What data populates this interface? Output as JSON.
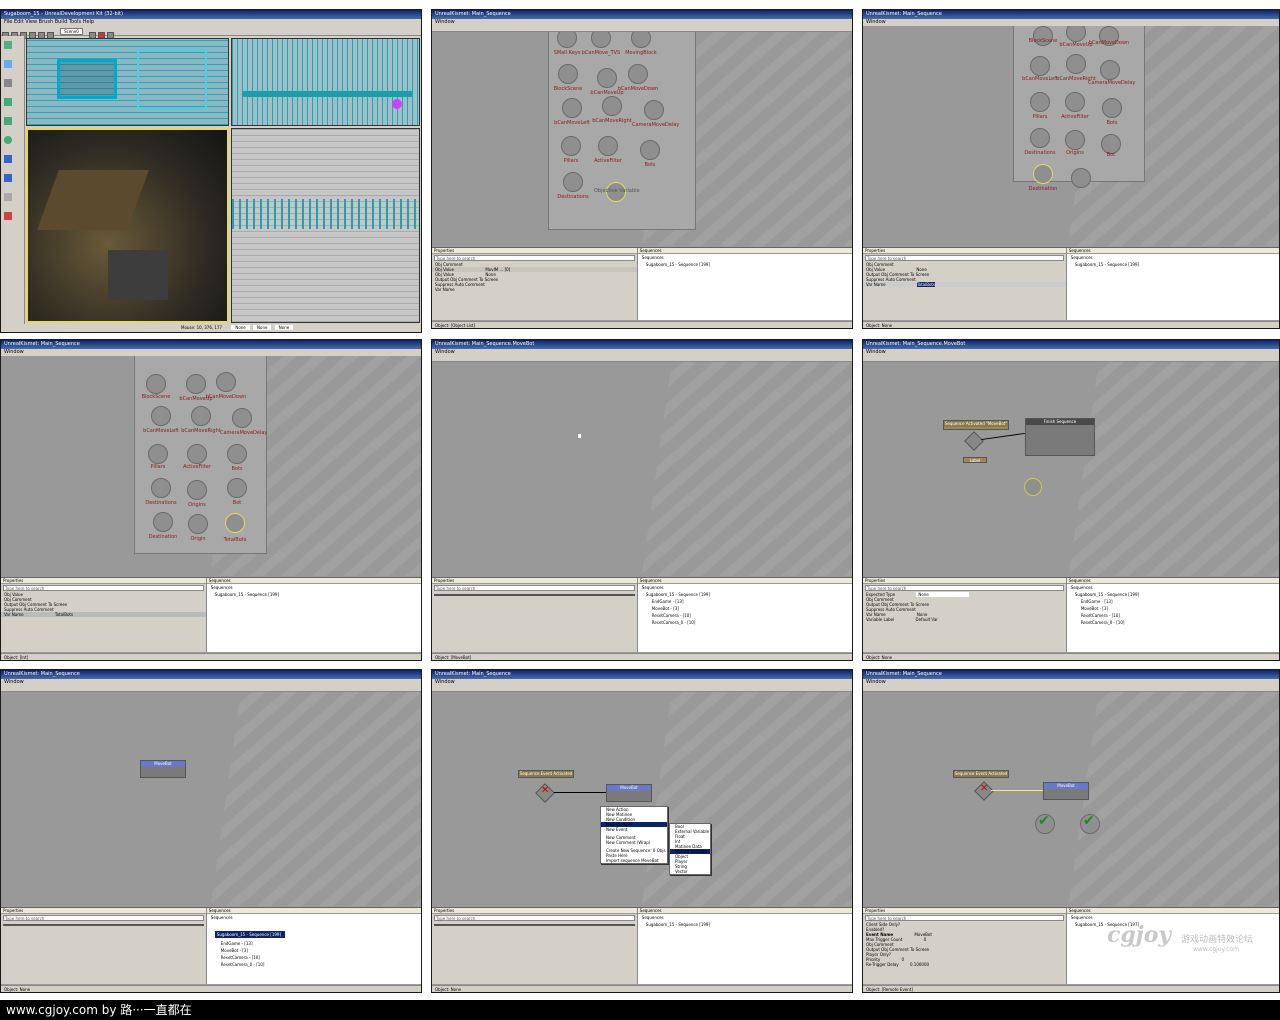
{
  "panels": {
    "p1": {
      "title": "Sugaboom_15 - UnrealDevelopment Kit (32-bit)",
      "menu": "File  Edit  View  Brush  Build  Tools  Help",
      "status": "Mouse: 10, 376, 177",
      "status_fields": [
        "None",
        "None",
        "None"
      ],
      "zoom": "Scene0"
    },
    "p2": {
      "title": "UnrealKismet: Main_Sequence",
      "menu": "Window",
      "nodes": [
        "SMall Keys",
        "bCanMove_TVS",
        "MovingBlock",
        "BlockScene",
        "bCanMoveUp",
        "bCanMoveDown",
        "bCanMoveLeft",
        "bCanMoveRight",
        "CameraMoveDelay",
        "Pillars",
        "ActiveFilter",
        "Bots",
        "Destinations",
        "Objective Variable"
      ],
      "props_header": "Properties",
      "search": "Type here to search",
      "props": [
        [
          "Obj Comment",
          ""
        ],
        [
          "Obj Value",
          "MovIM ... [0]"
        ],
        [
          "Obj Value",
          "None"
        ],
        [
          "Output Obj Comment To Screen",
          ""
        ],
        [
          "Suppress Auto Comment",
          ""
        ],
        [
          "Var Name",
          ""
        ]
      ],
      "seq_header": "Sequences",
      "tree": [
        "Sequences",
        "Sugaboom_15 - Sequence [199]"
      ],
      "status": "Object: [Object List]"
    },
    "p3": {
      "title": "UnrealKismet: Main_Sequence",
      "menu": "Window",
      "nodes": [
        "BlockScene",
        "bCanMoveUp",
        "bCanMoveDown",
        "bCanMoveLeft",
        "bCanMoveRight",
        "CameraMoveDelay",
        "Pillars",
        "ActiveFilter",
        "Bots",
        "Destinations",
        "Origins",
        "Bot",
        "Destination",
        ""
      ],
      "props_header": "Properties",
      "search": "Type here to search",
      "props": [
        [
          "Obj Comment",
          ""
        ],
        [
          "Obj Value",
          "None"
        ],
        [
          "Output Obj Comment To Screen",
          ""
        ],
        [
          "Suppress Auto Comment",
          ""
        ],
        [
          "Var Name",
          "TotalBots"
        ]
      ],
      "seq_header": "Sequences",
      "tree": [
        "Sequences",
        "Sugaboom_15 - Sequence [199]"
      ],
      "status": "Object: None"
    },
    "p4": {
      "title": "UnrealKismet: Main_Sequence",
      "menu": "Window",
      "nodes": [
        "BlockScene",
        "bCanMoveUp",
        "bCanMoveDown",
        "bCanMoveLeft",
        "bCanMoveRight",
        "CameraMoveDelay",
        "Pillars",
        "ActiveFilter",
        "Bots",
        "Destinations",
        "Origins",
        "Bot",
        "Destination",
        "Origin",
        "TotalBots"
      ],
      "props_header": "Properties",
      "search": "Type here to search",
      "props": [
        [
          "Obj Value",
          ""
        ],
        [
          "Obj Comment",
          ""
        ],
        [
          "Output Obj Comment To Screen",
          ""
        ],
        [
          "Suppress Auto Comment",
          ""
        ],
        [
          "Var Name",
          "TotalBots"
        ]
      ],
      "seq_header": "Sequences",
      "tree": [
        "Sequences",
        "Sugaboom_15 - Sequence [199]"
      ],
      "status": "Object: [Int]"
    },
    "p5": {
      "title": "UnrealKismet: Main_Sequence.MoveBot",
      "menu": "Window",
      "props_header": "Properties",
      "search": "Type here to search",
      "seq_header": "Sequences",
      "tree": [
        "Sequences",
        "Sugaboom_15 - Sequence [199]",
        "EndGame - [13]",
        "MoveBot - [3]",
        "ResetCamera - [10]",
        "ResetCamera_0 - [10]"
      ],
      "status": "Object: [MoveBot]"
    },
    "p6": {
      "title": "UnrealKismet: Main_Sequence.MoveBot",
      "menu": "Window",
      "event": "Sequence Activated \"MoveBot\"",
      "action": "Finish Sequence",
      "label": "Label",
      "props_header": "Properties",
      "search": "Type here to search",
      "props": [
        [
          "Expected Type",
          "None"
        ],
        [
          "Obj Comment",
          ""
        ],
        [
          "Output Obj Comment To Screen",
          ""
        ],
        [
          "Suppress Auto Comment",
          ""
        ],
        [
          "Var Name",
          "None"
        ],
        [
          "Variable Label",
          "Default Var"
        ]
      ],
      "seq_header": "Sequences",
      "tree": [
        "Sequences",
        "Sugaboom_15 - Sequence [199]",
        "EndGame - [13]",
        "MoveBot - [3]",
        "ResetCamera - [10]",
        "ResetCamera_0 - [10]"
      ],
      "status": "Object: None"
    },
    "p7": {
      "title": "UnrealKismet: Main_Sequence",
      "menu": "Window",
      "node": "MoveBot",
      "props_header": "Properties",
      "search": "Type here to search",
      "seq_header": "Sequences",
      "tree": [
        "Sequences",
        "Sugaboom_15 - Sequence [199]",
        "EndGame - [13]",
        "MoveBot - [3]",
        "ResetCamera - [10]",
        "ResetCamera_0 - [10]"
      ],
      "status": "Object: None"
    },
    "p8": {
      "title": "UnrealKismet: Main_Sequence",
      "menu": "Window",
      "event": "Sequence Event Activated",
      "node": "MoveBot",
      "menu_items": [
        "New Action",
        "New Matinee",
        "New Condition",
        "New Variable",
        "New Event",
        "New Comment",
        "New Comment (Wrap)",
        "Create New Sequence: 0 Objs",
        "Paste Here",
        "Import sequence MoveBot"
      ],
      "submenu_items": [
        "Bool",
        "External Variable",
        "Float",
        "Int",
        "Matinee Data",
        "Named Variable",
        "Object",
        "Player",
        "String",
        "Vector"
      ],
      "props_header": "Properties",
      "search": "Type here to search",
      "seq_header": "Sequences",
      "tree": [
        "Sequences",
        "Sugaboom_15 - Sequence [199]"
      ],
      "status": "Object: None"
    },
    "p9": {
      "title": "UnrealKismet: Main_Sequence",
      "menu": "Window",
      "event": "Sequence Event Activated",
      "node": "MoveBot",
      "props_header": "Properties",
      "search": "Type here to search",
      "props": [
        [
          "Client Side Only?",
          ""
        ],
        [
          "Enabled?",
          ""
        ],
        [
          "Event Name",
          "MoveBot"
        ],
        [
          "Max Trigger Count",
          "0"
        ],
        [
          "Obj Comment",
          ""
        ],
        [
          "Output Obj Comment To Screen",
          ""
        ],
        [
          "Player Only?",
          ""
        ],
        [
          "Priority",
          "0"
        ],
        [
          "Re-Trigger Delay",
          "0.100000"
        ]
      ],
      "seq_header": "Sequences",
      "tree": [
        "Sequences",
        "Sugaboom_15 - Sequence [197]"
      ],
      "status": "Object: [Remote Event]"
    }
  },
  "watermark": {
    "logo": "cgjoy",
    "chinese": "游戏动画特效论坛",
    "url": "www.cgjoy.com"
  },
  "caption": "www.cgjoy.com by 路···一直都在"
}
